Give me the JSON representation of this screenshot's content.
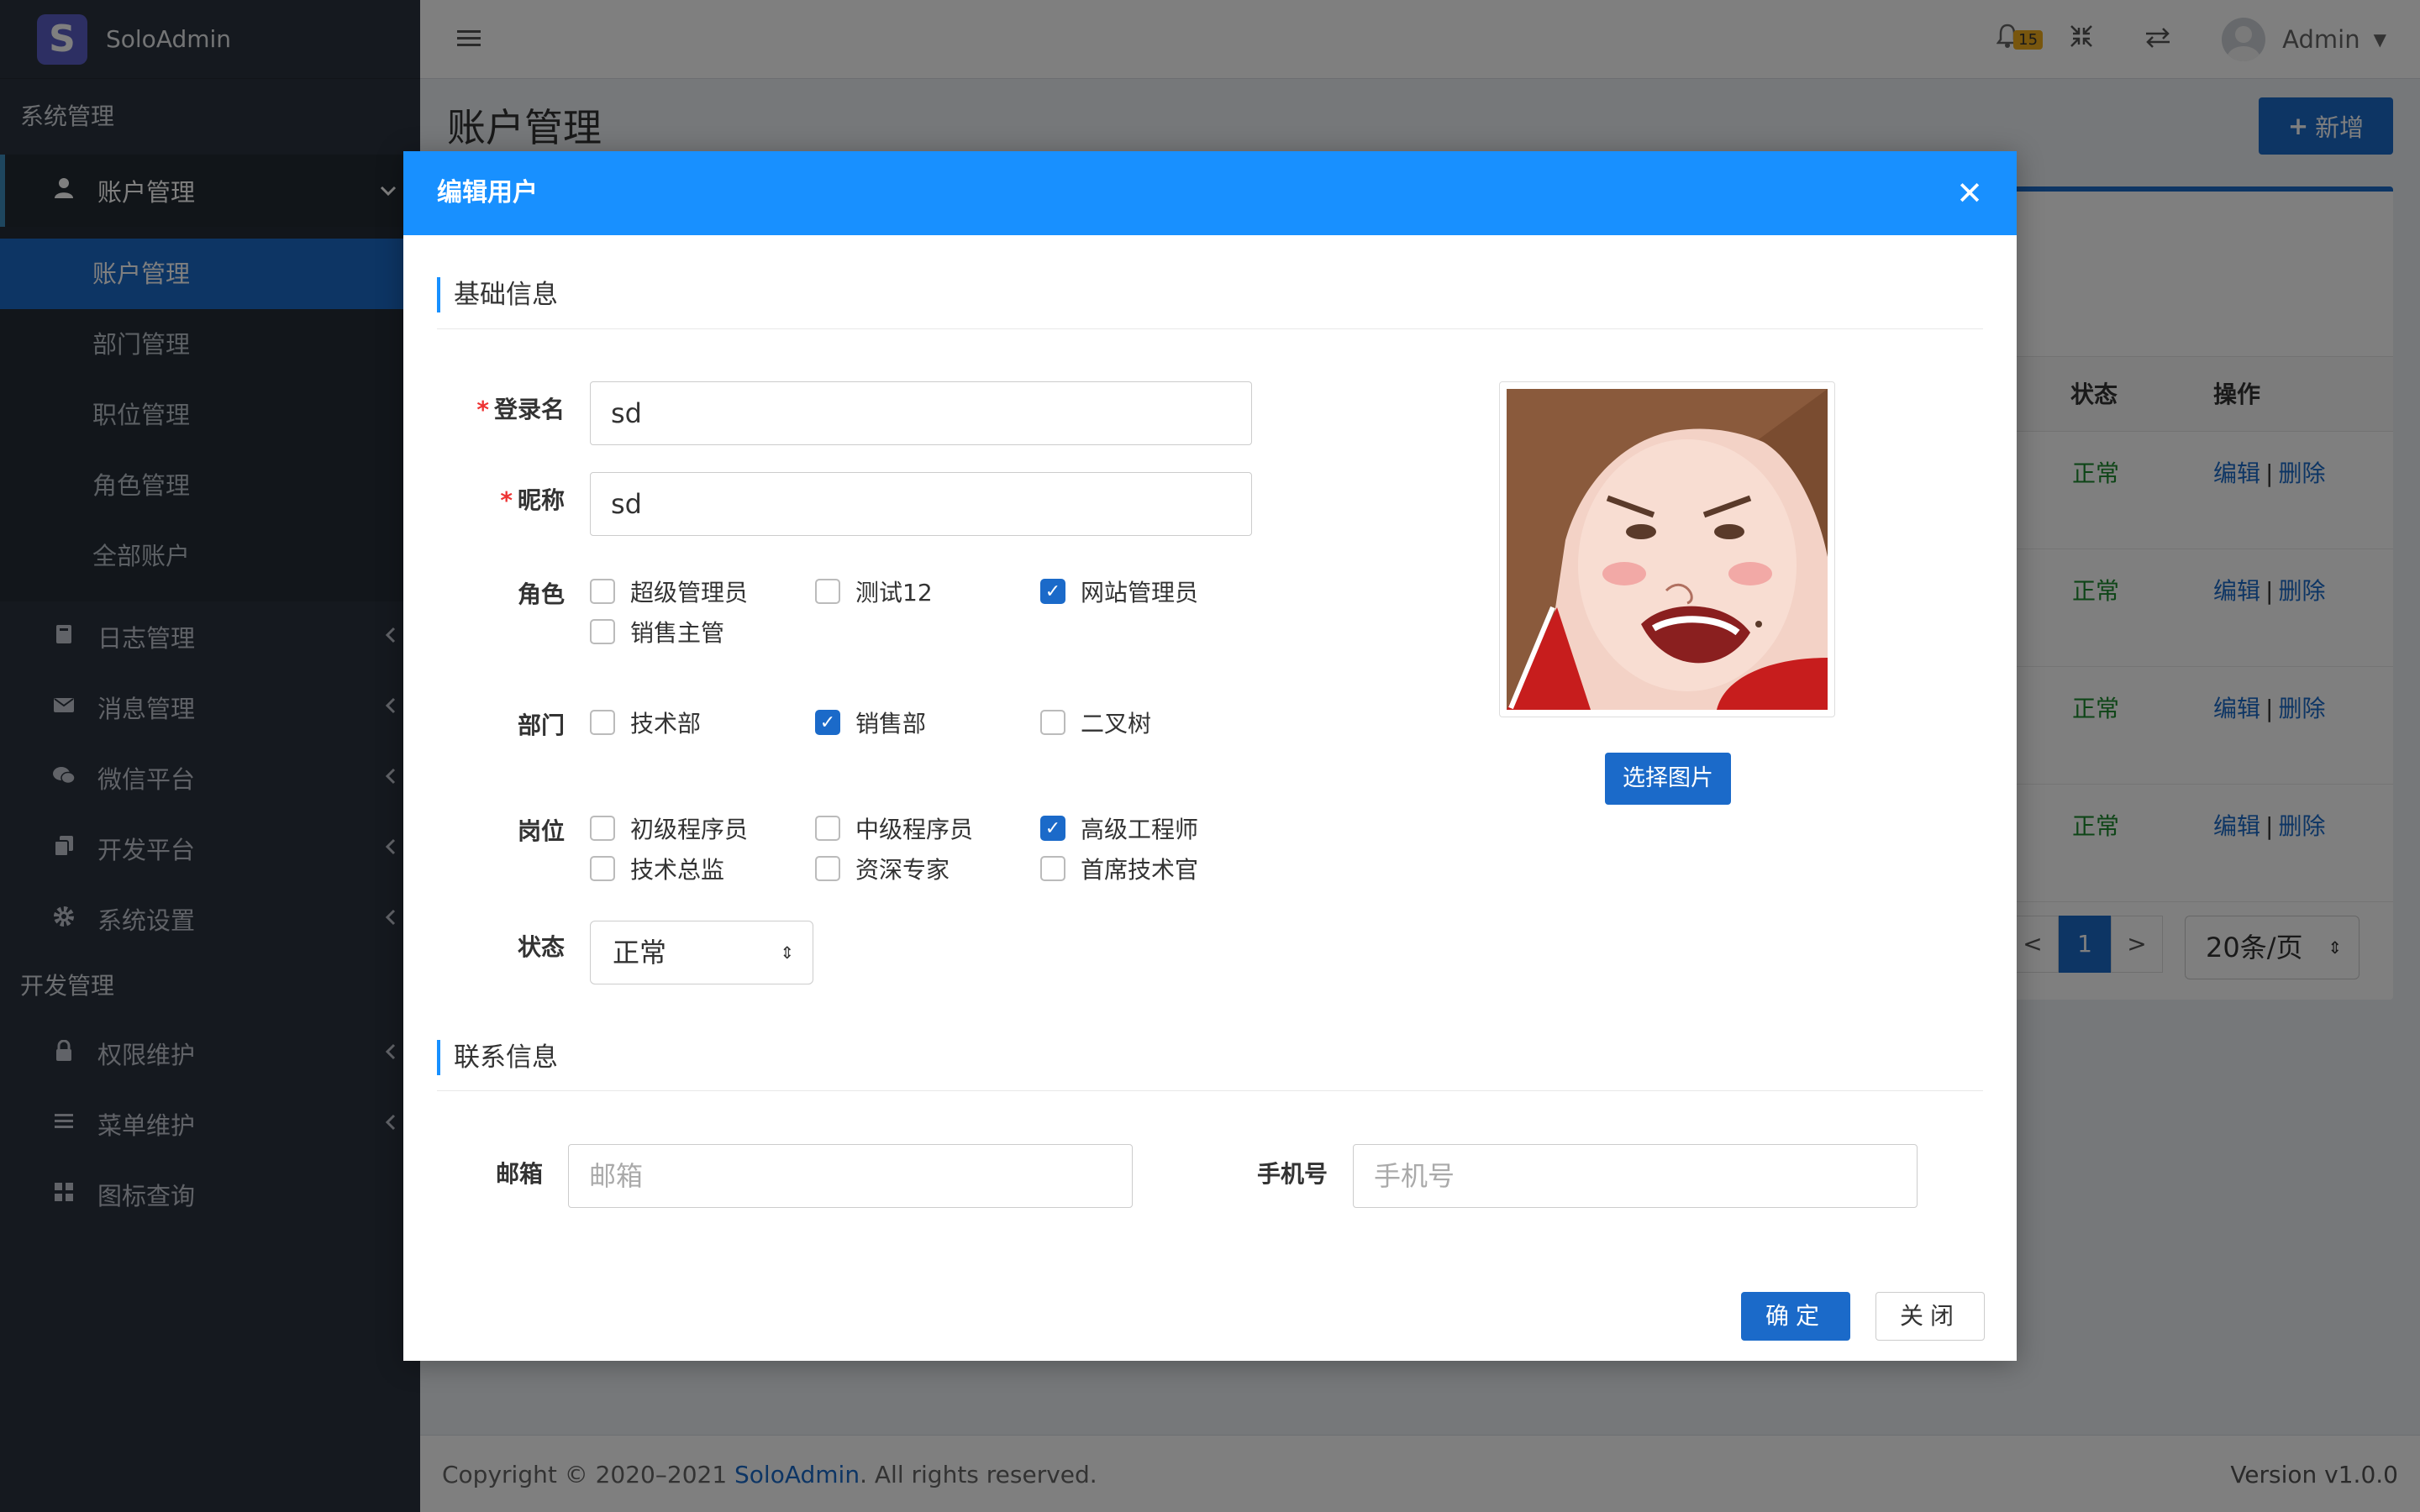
{
  "brand": {
    "logo_letter": "S",
    "name": "SoloAdmin"
  },
  "sidebar": {
    "section1": "系统管理",
    "account_group": {
      "label": "账户管理",
      "icon": "user-icon",
      "chevron": "chevron-down-icon"
    },
    "sub_items": [
      "账户管理",
      "部门管理",
      "职位管理",
      "角色管理",
      "全部账户"
    ],
    "items": [
      {
        "label": "日志管理",
        "icon": "book-icon"
      },
      {
        "label": "消息管理",
        "icon": "envelope-icon"
      },
      {
        "label": "微信平台",
        "icon": "wechat-icon"
      },
      {
        "label": "开发平台",
        "icon": "copy-icon"
      },
      {
        "label": "系统设置",
        "icon": "gear-icon"
      }
    ],
    "section2": "开发管理",
    "items2": [
      {
        "label": "权限维护",
        "icon": "lock-icon"
      },
      {
        "label": "菜单维护",
        "icon": "menu-icon"
      },
      {
        "label": "图标查询",
        "icon": "grid-icon"
      }
    ]
  },
  "topbar": {
    "notification_count": "15",
    "user_name": "Admin"
  },
  "page": {
    "title": "账户管理",
    "add_button": "新增"
  },
  "table": {
    "headers": {
      "status": "状态",
      "ops": "操作"
    },
    "rows": [
      {
        "status": "正常",
        "edit": "编辑",
        "delete": "删除"
      },
      {
        "status": "正常",
        "edit": "编辑",
        "delete": "删除"
      },
      {
        "status": "正常",
        "edit": "编辑",
        "delete": "删除"
      },
      {
        "status": "正常",
        "edit": "编辑",
        "delete": "删除"
      }
    ],
    "pager": {
      "prev": "<",
      "current": "1",
      "next": ">",
      "page_size": "20条/页"
    }
  },
  "footer": {
    "copyright_prefix": "Copyright © 2020–2021 ",
    "brand_link": "SoloAdmin",
    "copyright_suffix": ". All rights reserved.",
    "version": "Version v1.0.0"
  },
  "modal": {
    "title": "编辑用户",
    "section_basic": "基础信息",
    "login_label": "登录名",
    "login_value": "sd",
    "nick_label": "昵称",
    "nick_value": "sd",
    "role_label": "角色",
    "roles": [
      {
        "label": "超级管理员",
        "checked": false
      },
      {
        "label": "测试12",
        "checked": false
      },
      {
        "label": "网站管理员",
        "checked": true
      },
      {
        "label": "销售主管",
        "checked": false
      }
    ],
    "dept_label": "部门",
    "depts": [
      {
        "label": "技术部",
        "checked": false
      },
      {
        "label": "销售部",
        "checked": true
      },
      {
        "label": "二叉树",
        "checked": false
      }
    ],
    "post_label": "岗位",
    "posts": [
      {
        "label": "初级程序员",
        "checked": false
      },
      {
        "label": "中级程序员",
        "checked": false
      },
      {
        "label": "高级工程师",
        "checked": true
      },
      {
        "label": "技术总监",
        "checked": false
      },
      {
        "label": "资深专家",
        "checked": false
      },
      {
        "label": "首席技术官",
        "checked": false
      }
    ],
    "status_label": "状态",
    "status_value": "正常",
    "pick_image": "选择图片",
    "section_contact": "联系信息",
    "email_label": "邮箱",
    "email_placeholder": "邮箱",
    "phone_label": "手机号",
    "phone_placeholder": "手机号",
    "ok": "确定",
    "close": "关闭"
  }
}
